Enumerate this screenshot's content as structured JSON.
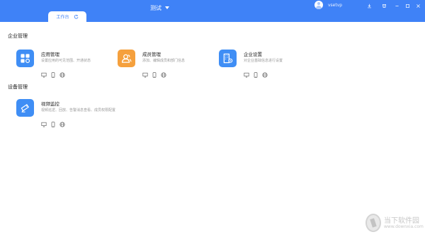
{
  "window": {
    "title": "测试",
    "username": "vsetvp"
  },
  "tabs": [
    {
      "label": "工作台"
    }
  ],
  "sections": [
    {
      "title": "企业管理",
      "cards": [
        {
          "name": "应用管理",
          "desc": "设置应用的可见范围、开通状态",
          "icon": "apps-grid-icon",
          "color": "#3f8ef5"
        },
        {
          "name": "成员管理",
          "desc": "添加、编辑成员和部门信息",
          "icon": "members-icon",
          "color": "#f5a03d"
        },
        {
          "name": "企业设置",
          "desc": "对企业基础信息进行设置",
          "icon": "enterprise-building-icon",
          "color": "#3f8ef5"
        }
      ]
    },
    {
      "title": "设备管理",
      "cards": [
        {
          "name": "视频监控",
          "desc": "视频巡逻、回放、告警消息查看、成员权限配置",
          "icon": "camera-icon",
          "color": "#3f8ef5"
        }
      ]
    }
  ],
  "platform_icons": [
    "desktop-icon",
    "mobile-icon",
    "web-globe-icon"
  ],
  "watermark": {
    "text": "当下软件园",
    "url": "www.downxia.com"
  }
}
